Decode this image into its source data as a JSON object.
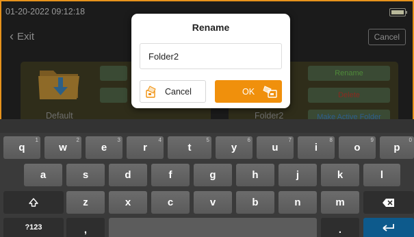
{
  "status": {
    "datetime": "01-20-2022 09:12:18",
    "battery_icon": "battery-icon"
  },
  "nav": {
    "exit_label": "Exit",
    "cancel_label": "Cancel"
  },
  "folders": [
    {
      "name": "Default"
    },
    {
      "name": "Folder2",
      "actions": [
        "Rename",
        "Delete",
        "Make Active Folder"
      ]
    }
  ],
  "dialog": {
    "title": "Rename",
    "input_value": "Folder2",
    "cancel_label": "Cancel",
    "ok_label": "OK"
  },
  "keyboard": {
    "row1": [
      {
        "label": "q",
        "hint": "1"
      },
      {
        "label": "w",
        "hint": "2"
      },
      {
        "label": "e",
        "hint": "3"
      },
      {
        "label": "r",
        "hint": "4"
      },
      {
        "label": "t",
        "hint": "5"
      },
      {
        "label": "y",
        "hint": "6"
      },
      {
        "label": "u",
        "hint": "7"
      },
      {
        "label": "i",
        "hint": "8"
      },
      {
        "label": "o",
        "hint": "9"
      },
      {
        "label": "p",
        "hint": "0"
      }
    ],
    "row2": [
      "a",
      "s",
      "d",
      "f",
      "g",
      "h",
      "j",
      "k",
      "l"
    ],
    "row3": [
      "z",
      "x",
      "c",
      "v",
      "b",
      "n",
      "m"
    ],
    "symbols_label": "?123",
    "comma_label": ",",
    "period_label": ".",
    "shift_icon": "shift-icon",
    "backspace_icon": "backspace-icon",
    "enter_icon": "enter-icon"
  },
  "colors": {
    "accent": "#f0900c",
    "frame": "#e8931c",
    "enter": "#0d5a8c"
  }
}
